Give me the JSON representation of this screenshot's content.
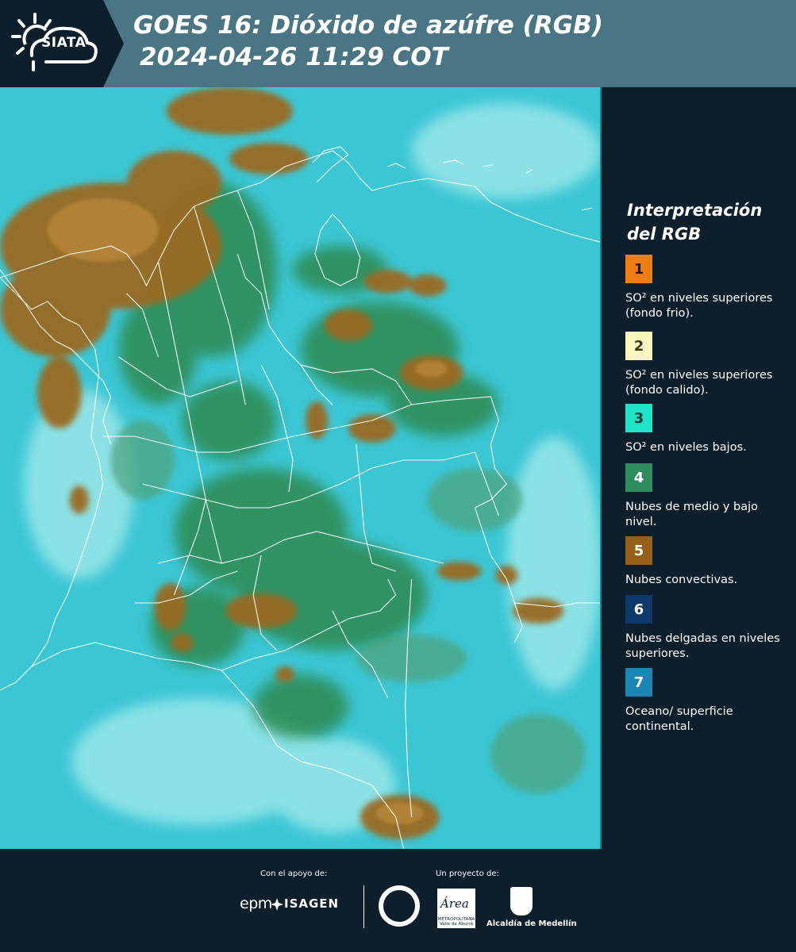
{
  "header": {
    "logo_text": "SIATA",
    "title_line1": "GOES 16: Dióxido de azúfre (RGB)",
    "title_line2": "2024-04-26 11:29 COT"
  },
  "legend": {
    "title": "Interpretación del RGB",
    "items": [
      {
        "number": "1",
        "color": "#f07d14",
        "label": "SO² en niveles superiores (fondo frio)."
      },
      {
        "number": "2",
        "color": "#fbf5c0",
        "label": "SO² en niveles superiores (fondo calido)."
      },
      {
        "number": "3",
        "color": "#1fe3c6",
        "label": "SO² en niveles bajos."
      },
      {
        "number": "4",
        "color": "#2e8c5e",
        "label": "Nubes de medio y bajo nivel."
      },
      {
        "number": "5",
        "color": "#956018",
        "label": "Nubes convectivas."
      },
      {
        "number": "6",
        "color": "#0d3a6a",
        "label": "Nubes delgadas en niveles superiores."
      },
      {
        "number": "7",
        "color": "#1b86b3",
        "label": "Oceano/ superficie continental."
      }
    ]
  },
  "footer": {
    "support_label": "Con el apoyo de:",
    "project_label": "Un proyecto de:",
    "sponsor_epm": "epm",
    "sponsor_isagen": "ISAGEN",
    "partner_area": "Área",
    "partner_area_sub": "METROPOLITANA Valle de Aburrá",
    "partner_alcaldia": "Alcaldía de Medellín"
  }
}
